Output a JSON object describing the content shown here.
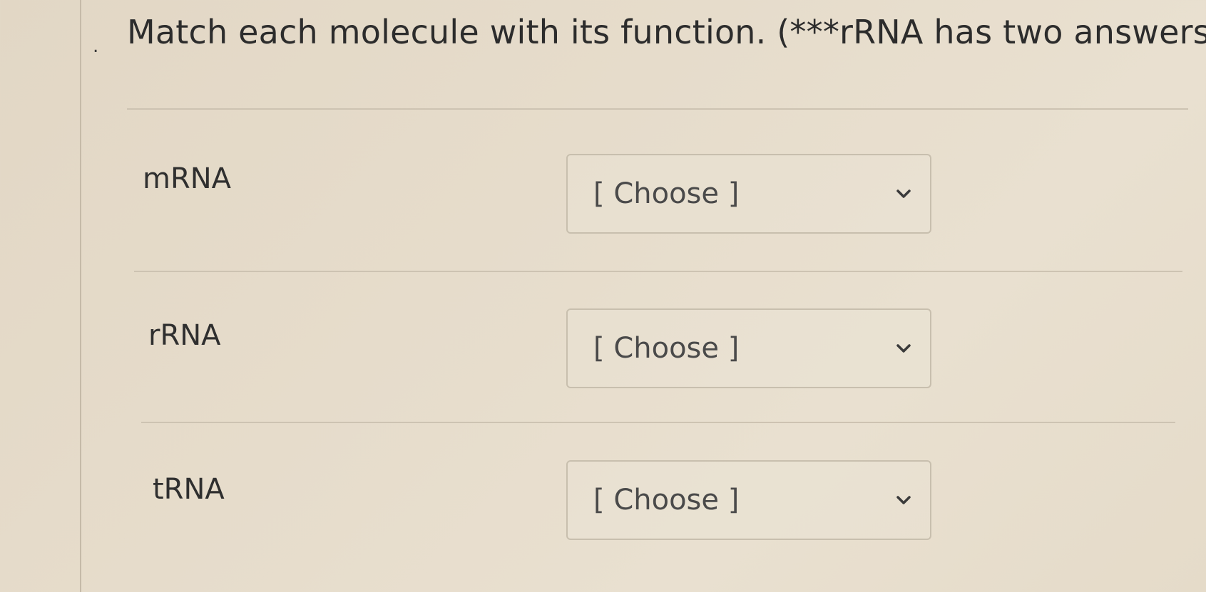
{
  "question": {
    "bullet": ".",
    "text": "Match each molecule with its function. (***rRNA has two answers)"
  },
  "rows": [
    {
      "label": "mRNA",
      "select_value": "[ Choose ]"
    },
    {
      "label": "rRNA",
      "select_value": "[ Choose ]"
    },
    {
      "label": "tRNA",
      "select_value": "[ Choose ]"
    }
  ],
  "icons": {
    "dropdown": "chevron-down-icon"
  },
  "colors": {
    "background": "#e6dccb",
    "text": "#2e2e2e",
    "border": "#c8bfae"
  }
}
